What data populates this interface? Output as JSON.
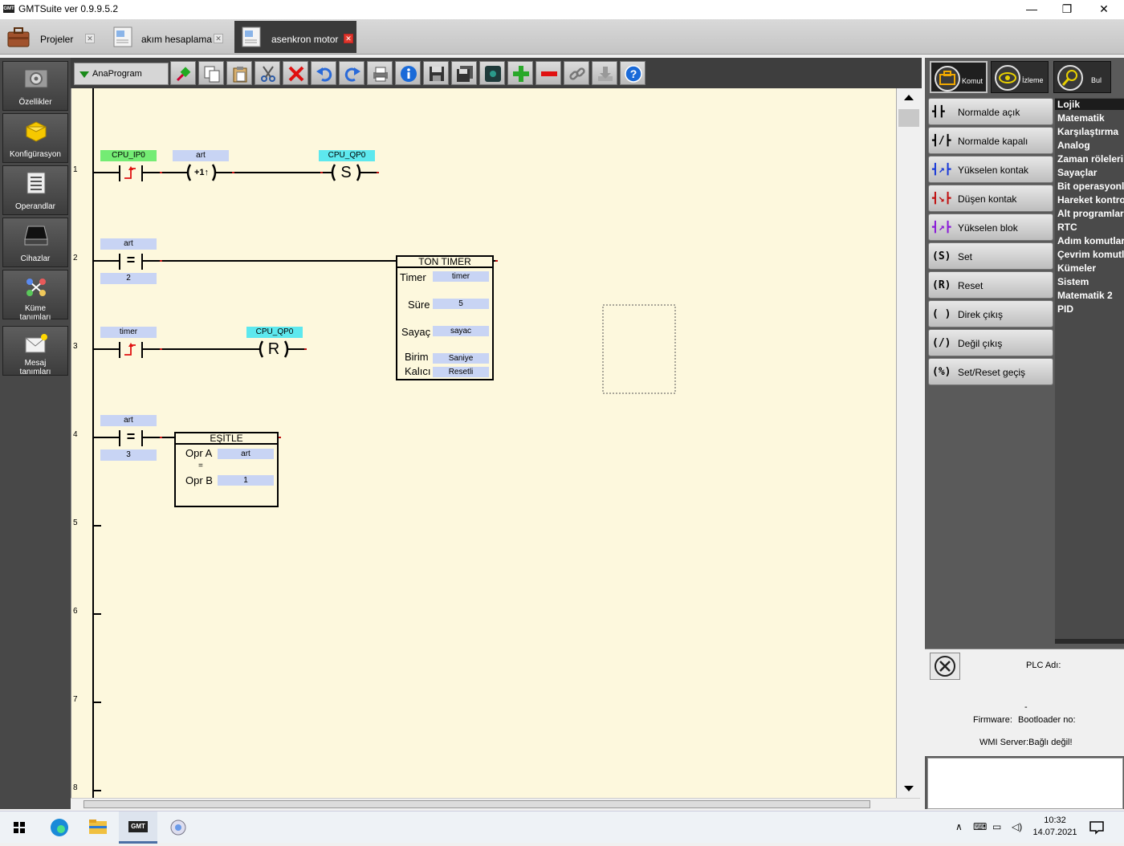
{
  "window": {
    "title": "GMTSuite ver 0.9.9.5.2",
    "logo_text": "GMT",
    "minimize": "—",
    "maximize": "❐",
    "close": "✕"
  },
  "file_tabs": [
    {
      "label": "Projeler",
      "close": "✕"
    },
    {
      "label": "akım hesaplama",
      "close": "✕"
    },
    {
      "label": "asenkron motor",
      "close": "✕"
    }
  ],
  "left_nav": [
    {
      "label": "Özellikler"
    },
    {
      "label": "Konfigürasyon"
    },
    {
      "label": "Operandlar"
    },
    {
      "label": "Cihazlar"
    },
    {
      "label_line1": "Küme",
      "label_line2": "tanımları"
    },
    {
      "label_line1": "Mesaj",
      "label_line2": "tanımları"
    }
  ],
  "toolbar": {
    "program_select": "AnaProgram",
    "icons": [
      "connect-icon",
      "copy-icon",
      "paste-icon",
      "cut-icon",
      "delete-icon",
      "undo-icon",
      "redo-icon",
      "print-icon",
      "info-icon",
      "save-icon",
      "save-all-icon",
      "monitor-icon",
      "add-icon",
      "remove-icon",
      "link-icon",
      "download-icon",
      "help-icon"
    ]
  },
  "ladder": {
    "rung_numbers": [
      "1",
      "2",
      "3",
      "4",
      "5",
      "6",
      "7",
      "8"
    ],
    "rung1": {
      "contact_tag": "CPU_IP0",
      "inc_tag": "art",
      "inc_symbol": "+1",
      "coil_tag": "CPU_QP0",
      "coil_symbol": "S"
    },
    "rung2": {
      "cmp_tag": "art",
      "cmp_symbol": "=",
      "cmp_value": "2"
    },
    "rung3": {
      "contact_tag": "timer",
      "coil_tag": "CPU_QP0",
      "coil_symbol": "R"
    },
    "rung4": {
      "cmp_tag": "art",
      "cmp_symbol": "=",
      "cmp_value": "3"
    },
    "timer_block": {
      "title": "TON TIMER",
      "rows": [
        {
          "label": "Timer",
          "value": "timer"
        },
        {
          "label": "Süre",
          "value": "5"
        },
        {
          "label": "Sayaç",
          "value": "sayac"
        },
        {
          "label": "Birim",
          "value": "Saniye"
        },
        {
          "label": "Kalıcı",
          "value": "Resetli"
        }
      ]
    },
    "esitle_block": {
      "title": "EŞİTLE",
      "opr_a_label": "Opr A",
      "opr_a_value": "art",
      "eq": "=",
      "opr_b_label": "Opr B",
      "opr_b_value": "1"
    }
  },
  "right_tabs": [
    {
      "label": "Komut",
      "icon": "command-icon"
    },
    {
      "label": "İzleme",
      "icon": "eye-icon"
    },
    {
      "label": "Bul",
      "icon": "magnifier-icon"
    }
  ],
  "commands": [
    {
      "symbol": "┫┣",
      "label": "Normalde açık"
    },
    {
      "symbol": "┫/┣",
      "label": "Normalde kapalı"
    },
    {
      "symbol": "┫↗┣",
      "label": "Yükselen kontak"
    },
    {
      "symbol": "┫↘┣",
      "label": "Düşen kontak"
    },
    {
      "symbol": "┫↗┣",
      "label": "Yükselen blok"
    },
    {
      "symbol": "(S)",
      "label": "Set"
    },
    {
      "symbol": "(R)",
      "label": "Reset"
    },
    {
      "symbol": "( )",
      "label": "Direk çıkış"
    },
    {
      "symbol": "(/)",
      "label": "Değil çıkış"
    },
    {
      "symbol": "(%)",
      "label": "Set/Reset geçiş"
    }
  ],
  "categories": [
    "Lojik",
    "Matematik",
    "Karşılaştırma",
    "Analog",
    "Zaman röleleri",
    "Sayaçlar",
    "Bit operasyonları",
    "Hareket kontrol",
    "Alt programlar",
    "RTC",
    "Adım komutları",
    "Çevrim komutları",
    "Kümeler",
    "Sistem",
    "Matematik 2",
    "PID"
  ],
  "status": {
    "plc_label": "PLC Adı:",
    "dash": "-",
    "firmware_label": "Firmware:",
    "bootloader_label": "Bootloader no:",
    "wmi": "WMI Server:Bağlı değil!"
  },
  "taskbar": {
    "time": "10:32",
    "date": "14.07.2021",
    "gmt_label": "GMT"
  }
}
